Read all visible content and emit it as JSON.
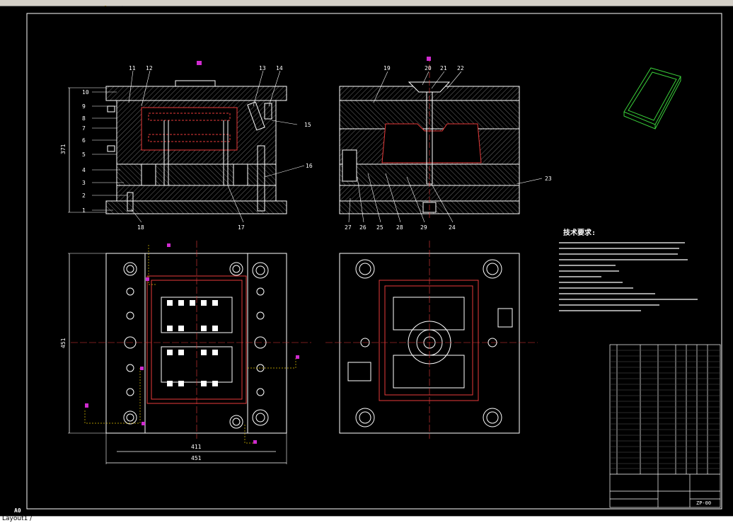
{
  "toolbar": {
    "icon_a": "pencil-icon",
    "icon_b": "layers-icon"
  },
  "drawing": {
    "sheet_label": "A0",
    "front_view_labels": [
      "11",
      "12",
      "10",
      "9",
      "8",
      "7",
      "6",
      "5",
      "4",
      "3",
      "2",
      "1",
      "18",
      "17",
      "16",
      "15",
      "14",
      "13"
    ],
    "side_view_labels": [
      "19",
      "20",
      "21",
      "22",
      "23",
      "24",
      "27",
      "26",
      "25",
      "28",
      "29"
    ],
    "dim_height": "371",
    "dim_plan_height": "451",
    "dim_inner_width": "411",
    "dim_outer_width": "451",
    "tech_requirements_title": "技术要求:",
    "title_block_code": "ZP-00"
  },
  "statusbar": {
    "prompt": "Layout1 /"
  }
}
